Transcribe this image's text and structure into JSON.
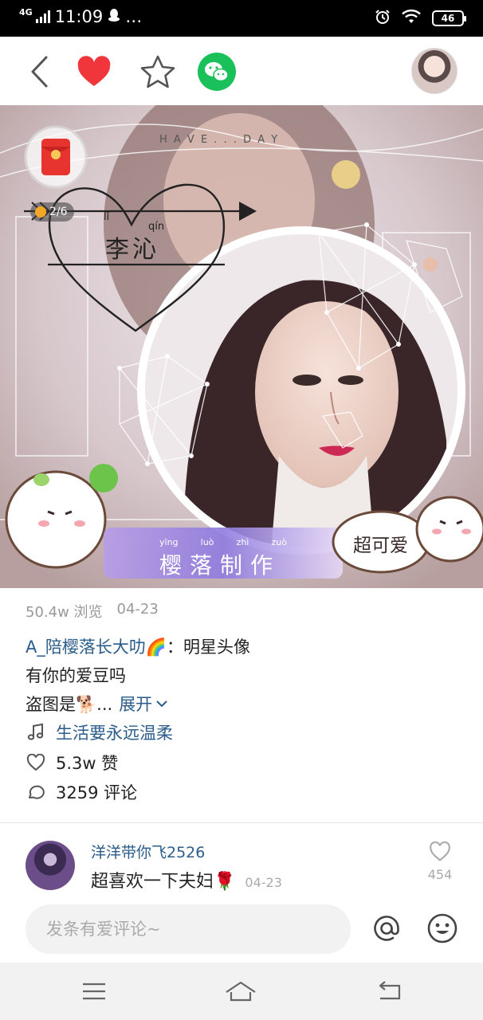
{
  "status_bar": {
    "network": "4G",
    "time": "11:09",
    "more": "…",
    "battery": "46"
  },
  "hero": {
    "badge": "2/6",
    "heart_pinyin_left": "lǐ",
    "heart_pinyin_right": "qín",
    "heart_name": "李沁",
    "banner_pinyin": [
      "yīng",
      "luò",
      "zhì",
      "zuò"
    ],
    "banner_text": "樱落制作",
    "sticker_text": "超可爱",
    "top_text": "H A V E  .  .  .  D A Y"
  },
  "post": {
    "views": "50.4w 浏览",
    "date": "04-23",
    "author": "A_陪樱落长大叻🌈",
    "colon": "：",
    "category": "明星头像",
    "line2": "有你的爱豆吗",
    "line3": "盗图是🐕...",
    "expand": "展开",
    "music": "生活要永远温柔",
    "likes": "5.3w 赞",
    "comments": "3259 评论"
  },
  "comment": {
    "username": "洋洋带你飞2526",
    "text": "超喜欢一下夫妇🌹",
    "date": "04-23",
    "likes": "454"
  },
  "comment_bar": {
    "placeholder": "发条有爱评论~"
  },
  "colors": {
    "heart_red": "#f0353b",
    "wechat_green": "#1ac15a",
    "link_blue": "#2b5c8a"
  }
}
